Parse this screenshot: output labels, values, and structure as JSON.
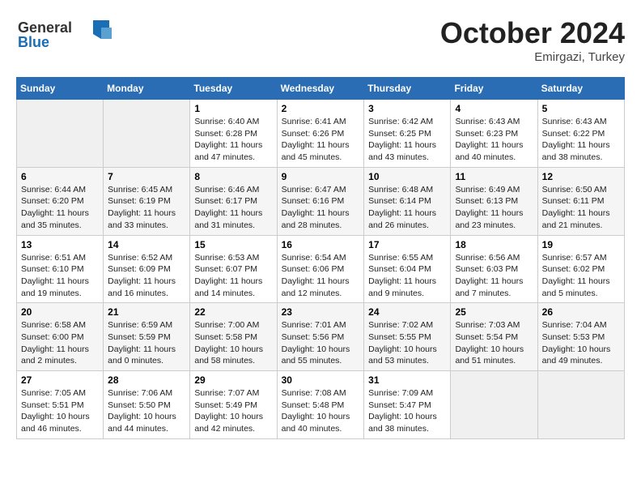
{
  "header": {
    "logo_line1": "General",
    "logo_line2": "Blue",
    "month_title": "October 2024",
    "location": "Emirgazi, Turkey"
  },
  "weekdays": [
    "Sunday",
    "Monday",
    "Tuesday",
    "Wednesday",
    "Thursday",
    "Friday",
    "Saturday"
  ],
  "weeks": [
    [
      {
        "day": "",
        "empty": true
      },
      {
        "day": "",
        "empty": true
      },
      {
        "day": "1",
        "sunrise": "6:40 AM",
        "sunset": "6:28 PM",
        "daylight": "11 hours and 47 minutes."
      },
      {
        "day": "2",
        "sunrise": "6:41 AM",
        "sunset": "6:26 PM",
        "daylight": "11 hours and 45 minutes."
      },
      {
        "day": "3",
        "sunrise": "6:42 AM",
        "sunset": "6:25 PM",
        "daylight": "11 hours and 43 minutes."
      },
      {
        "day": "4",
        "sunrise": "6:43 AM",
        "sunset": "6:23 PM",
        "daylight": "11 hours and 40 minutes."
      },
      {
        "day": "5",
        "sunrise": "6:43 AM",
        "sunset": "6:22 PM",
        "daylight": "11 hours and 38 minutes."
      }
    ],
    [
      {
        "day": "6",
        "sunrise": "6:44 AM",
        "sunset": "6:20 PM",
        "daylight": "11 hours and 35 minutes."
      },
      {
        "day": "7",
        "sunrise": "6:45 AM",
        "sunset": "6:19 PM",
        "daylight": "11 hours and 33 minutes."
      },
      {
        "day": "8",
        "sunrise": "6:46 AM",
        "sunset": "6:17 PM",
        "daylight": "11 hours and 31 minutes."
      },
      {
        "day": "9",
        "sunrise": "6:47 AM",
        "sunset": "6:16 PM",
        "daylight": "11 hours and 28 minutes."
      },
      {
        "day": "10",
        "sunrise": "6:48 AM",
        "sunset": "6:14 PM",
        "daylight": "11 hours and 26 minutes."
      },
      {
        "day": "11",
        "sunrise": "6:49 AM",
        "sunset": "6:13 PM",
        "daylight": "11 hours and 23 minutes."
      },
      {
        "day": "12",
        "sunrise": "6:50 AM",
        "sunset": "6:11 PM",
        "daylight": "11 hours and 21 minutes."
      }
    ],
    [
      {
        "day": "13",
        "sunrise": "6:51 AM",
        "sunset": "6:10 PM",
        "daylight": "11 hours and 19 minutes."
      },
      {
        "day": "14",
        "sunrise": "6:52 AM",
        "sunset": "6:09 PM",
        "daylight": "11 hours and 16 minutes."
      },
      {
        "day": "15",
        "sunrise": "6:53 AM",
        "sunset": "6:07 PM",
        "daylight": "11 hours and 14 minutes."
      },
      {
        "day": "16",
        "sunrise": "6:54 AM",
        "sunset": "6:06 PM",
        "daylight": "11 hours and 12 minutes."
      },
      {
        "day": "17",
        "sunrise": "6:55 AM",
        "sunset": "6:04 PM",
        "daylight": "11 hours and 9 minutes."
      },
      {
        "day": "18",
        "sunrise": "6:56 AM",
        "sunset": "6:03 PM",
        "daylight": "11 hours and 7 minutes."
      },
      {
        "day": "19",
        "sunrise": "6:57 AM",
        "sunset": "6:02 PM",
        "daylight": "11 hours and 5 minutes."
      }
    ],
    [
      {
        "day": "20",
        "sunrise": "6:58 AM",
        "sunset": "6:00 PM",
        "daylight": "11 hours and 2 minutes."
      },
      {
        "day": "21",
        "sunrise": "6:59 AM",
        "sunset": "5:59 PM",
        "daylight": "11 hours and 0 minutes."
      },
      {
        "day": "22",
        "sunrise": "7:00 AM",
        "sunset": "5:58 PM",
        "daylight": "10 hours and 58 minutes."
      },
      {
        "day": "23",
        "sunrise": "7:01 AM",
        "sunset": "5:56 PM",
        "daylight": "10 hours and 55 minutes."
      },
      {
        "day": "24",
        "sunrise": "7:02 AM",
        "sunset": "5:55 PM",
        "daylight": "10 hours and 53 minutes."
      },
      {
        "day": "25",
        "sunrise": "7:03 AM",
        "sunset": "5:54 PM",
        "daylight": "10 hours and 51 minutes."
      },
      {
        "day": "26",
        "sunrise": "7:04 AM",
        "sunset": "5:53 PM",
        "daylight": "10 hours and 49 minutes."
      }
    ],
    [
      {
        "day": "27",
        "sunrise": "7:05 AM",
        "sunset": "5:51 PM",
        "daylight": "10 hours and 46 minutes."
      },
      {
        "day": "28",
        "sunrise": "7:06 AM",
        "sunset": "5:50 PM",
        "daylight": "10 hours and 44 minutes."
      },
      {
        "day": "29",
        "sunrise": "7:07 AM",
        "sunset": "5:49 PM",
        "daylight": "10 hours and 42 minutes."
      },
      {
        "day": "30",
        "sunrise": "7:08 AM",
        "sunset": "5:48 PM",
        "daylight": "10 hours and 40 minutes."
      },
      {
        "day": "31",
        "sunrise": "7:09 AM",
        "sunset": "5:47 PM",
        "daylight": "10 hours and 38 minutes."
      },
      {
        "day": "",
        "empty": true
      },
      {
        "day": "",
        "empty": true
      }
    ]
  ],
  "labels": {
    "sunrise_prefix": "Sunrise: ",
    "sunset_prefix": "Sunset: ",
    "daylight_prefix": "Daylight: "
  }
}
